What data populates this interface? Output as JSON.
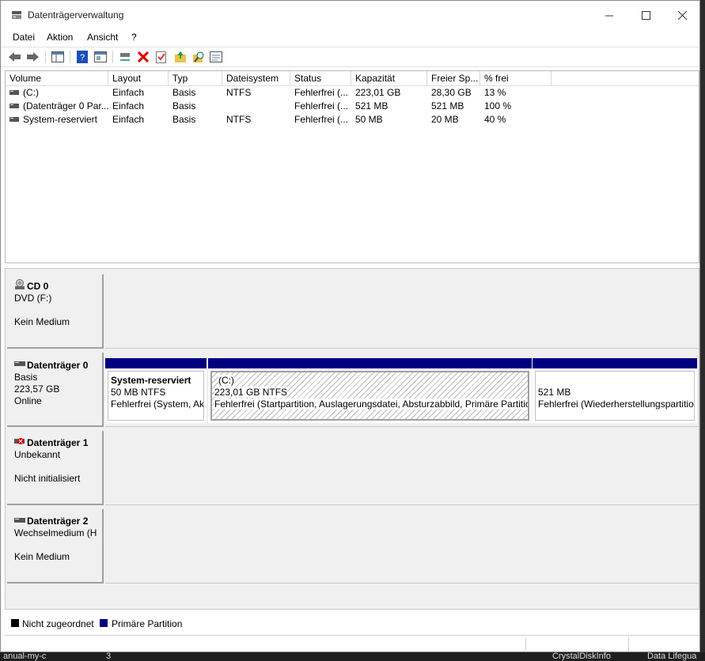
{
  "window": {
    "title": "Datenträgerverwaltung"
  },
  "menu": [
    "Datei",
    "Aktion",
    "Ansicht",
    "?"
  ],
  "toolbar_icons": [
    "back-icon",
    "forward-icon",
    "console-tree-icon",
    "help-icon",
    "properties-icon",
    "connect-icon",
    "delete-icon",
    "check-icon",
    "folder-up-icon",
    "search-icon",
    "view-icon"
  ],
  "volumes": {
    "headers": [
      "Volume",
      "Layout",
      "Typ",
      "Dateisystem",
      "Status",
      "Kapazität",
      "Freier Sp...",
      "% frei"
    ],
    "rows": [
      [
        "(C:)",
        "Einfach",
        "Basis",
        "NTFS",
        "Fehlerfrei (...",
        "223,01 GB",
        "28,30 GB",
        "13 %"
      ],
      [
        "(Datenträger 0 Par...",
        "Einfach",
        "Basis",
        "",
        "Fehlerfrei (...",
        "521 MB",
        "521 MB",
        "100 %"
      ],
      [
        "System-reserviert",
        "Einfach",
        "Basis",
        "NTFS",
        "Fehlerfrei (...",
        "50 MB",
        "20 MB",
        "40 %"
      ]
    ]
  },
  "disks": {
    "cd0": {
      "name": "CD 0",
      "line1": "DVD (F:)",
      "line2": "",
      "line3": "Kein Medium"
    },
    "d0": {
      "name": "Datenträger 0",
      "line1": "Basis",
      "line2": "223,57 GB",
      "line3": "Online",
      "partitions": [
        {
          "title": "System-reserviert",
          "size": "50 MB NTFS",
          "status": "Fehlerfrei (System, Ak"
        },
        {
          "title": "(C:)",
          "size": "223,01 GB NTFS",
          "status": "Fehlerfrei (Startpartition, Auslagerungsdatei, Absturzabbild, Primäre Partitic"
        },
        {
          "title": "",
          "size": "521 MB",
          "status": "Fehlerfrei (Wiederherstellungspartitio"
        }
      ]
    },
    "d1": {
      "name": "Datenträger 1",
      "line1": "Unbekannt",
      "line2": "",
      "line3": "Nicht initialisiert"
    },
    "d2": {
      "name": "Datenträger 2",
      "line1": "Wechselmedium (H",
      "line2": "",
      "line3": "Kein Medium"
    }
  },
  "legend": [
    {
      "label": "Nicht zugeordnet",
      "color": "#000000"
    },
    {
      "label": "Primäre Partition",
      "color": "#000080"
    }
  ],
  "taskbar": [
    "anual-my-c",
    "3",
    "CrystalDiskInfo",
    "Data Lifegua"
  ]
}
